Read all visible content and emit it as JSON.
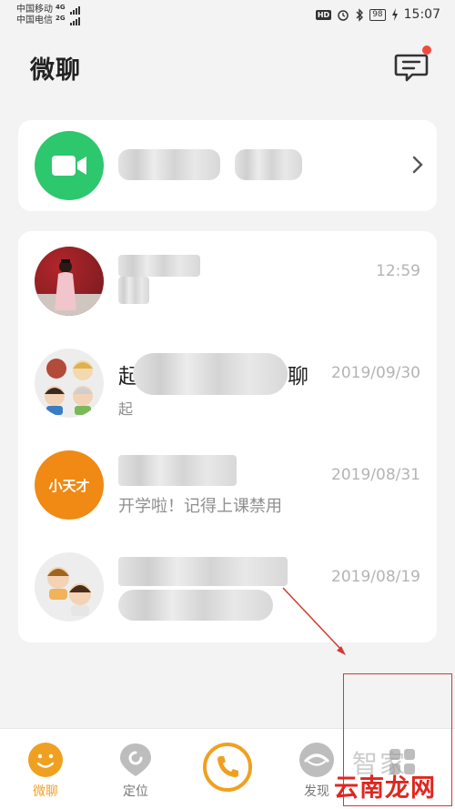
{
  "status_bar": {
    "carrier_1": "中国移动",
    "carrier_1_net": "4G",
    "carrier_2": "中国电信",
    "carrier_2_net": "2G",
    "hd": "HD",
    "battery": "98",
    "time": "15:07"
  },
  "header": {
    "title": "微聊",
    "message_icon": "chat-bubble-icon"
  },
  "video_call_card": {
    "icon": "video-camera-icon",
    "chevron": "chevron-right-icon"
  },
  "chats": [
    {
      "time": "12:59",
      "name": "",
      "preview": ""
    },
    {
      "time": "2019/09/30",
      "name_start": "起",
      "name_end": "聊",
      "preview_start": "起"
    },
    {
      "time": "2019/08/31",
      "avatar_text": "小天才",
      "name": "",
      "preview": "开学啦！记得上课禁用"
    },
    {
      "time": "2019/08/19",
      "name": "",
      "preview": ""
    }
  ],
  "bottom_nav": {
    "items": [
      {
        "label": "微聊",
        "icon": "smiley-icon",
        "active": true
      },
      {
        "label": "定位",
        "icon": "location-icon",
        "active": false
      },
      {
        "label": "",
        "icon": "phone-icon",
        "active": false
      },
      {
        "label": "发现",
        "icon": "discover-icon",
        "active": false
      }
    ]
  },
  "watermark": {
    "line_1": "智家",
    "line_2": "云南龙网"
  },
  "colors": {
    "accent": "#f0a020",
    "video_green": "#2dc76d",
    "badge_red": "#f24a3a",
    "brand_orange": "#f08a14"
  }
}
